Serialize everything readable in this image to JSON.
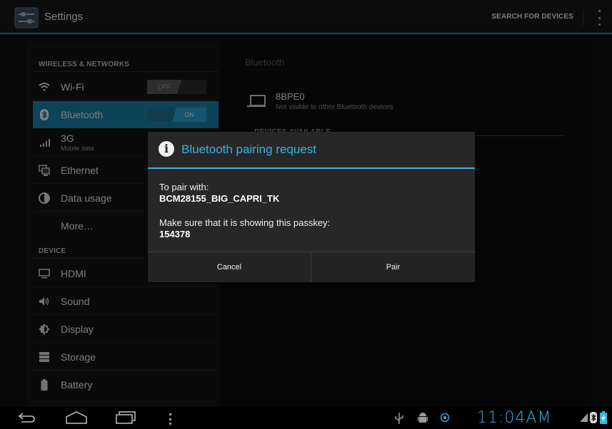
{
  "action_bar": {
    "title": "Settings",
    "search_label": "SEARCH FOR DEVICES"
  },
  "sidebar": {
    "wireless_header": "WIRELESS & NETWORKS",
    "device_header": "DEVICE",
    "items": [
      {
        "label": "Wi-Fi",
        "toggle": "OFF",
        "icon": "wifi-icon"
      },
      {
        "label": "Bluetooth",
        "toggle": "ON",
        "icon": "bluetooth-icon",
        "active": true
      },
      {
        "label": "3G",
        "sublabel": "Mobile data",
        "icon": "signal-icon"
      },
      {
        "label": "Ethernet",
        "icon": "ethernet-icon"
      },
      {
        "label": "Data usage",
        "icon": "data-usage-icon"
      },
      {
        "label": "More…"
      },
      {
        "label": "HDMI",
        "icon": "hdmi-icon"
      },
      {
        "label": "Sound",
        "icon": "sound-icon"
      },
      {
        "label": "Display",
        "icon": "display-icon"
      },
      {
        "label": "Storage",
        "icon": "storage-icon"
      },
      {
        "label": "Battery",
        "icon": "battery-icon"
      }
    ]
  },
  "bluetooth_pane": {
    "header": "Bluetooth",
    "device_name": "8BPE0",
    "device_status": "Not visible to other Bluetooth devices",
    "available_header": "DEVICES AVAILABLE"
  },
  "dialog": {
    "title": "Bluetooth pairing request",
    "pair_with_label": "To pair with:",
    "device": "BCM28155_BIG_CAPRI_TK",
    "passkey_prompt": "Make sure that it is showing this passkey:",
    "passkey": "154378",
    "cancel_label": "Cancel",
    "pair_label": "Pair"
  },
  "status_bar": {
    "time": "11:04AM"
  },
  "colors": {
    "accent": "#34b4e3",
    "active_item": "#1b7ca2"
  }
}
